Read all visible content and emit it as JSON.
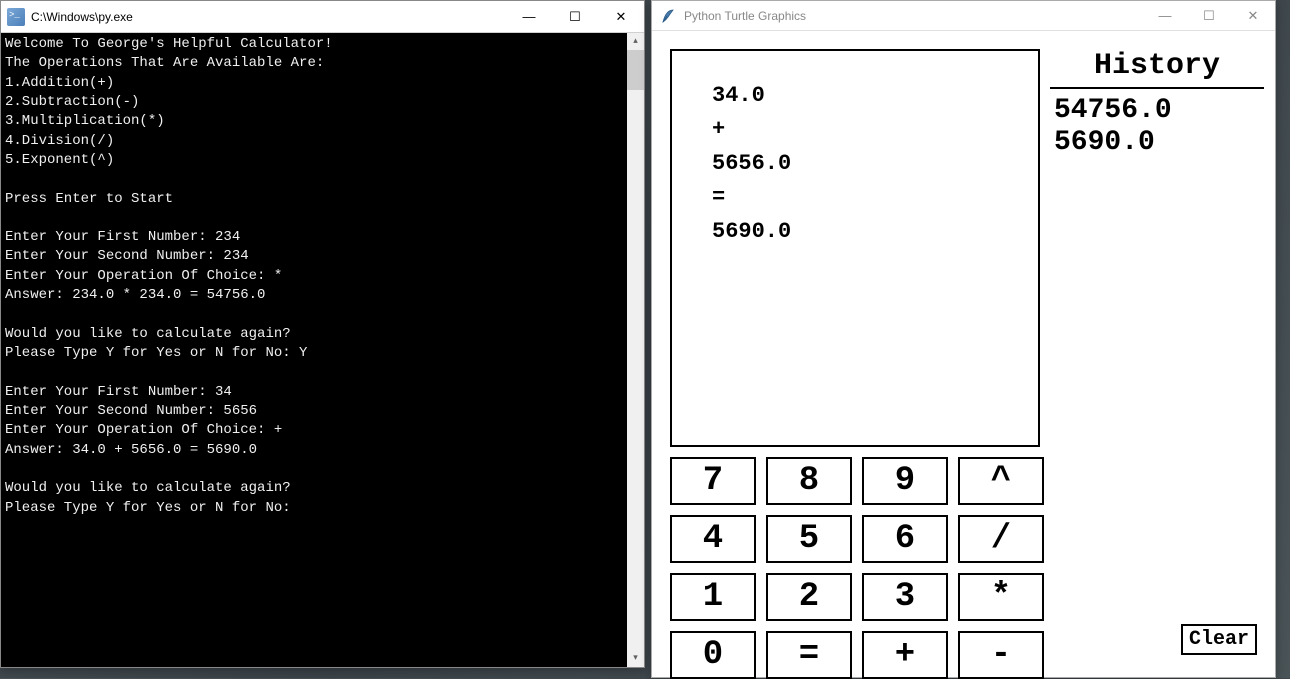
{
  "console": {
    "title": "C:\\Windows\\py.exe",
    "lines": [
      "Welcome To George's Helpful Calculator!",
      "The Operations That Are Available Are:",
      "1.Addition(+)",
      "2.Subtraction(-)",
      "3.Multiplication(*)",
      "4.Division(/)",
      "5.Exponent(^)",
      "",
      "Press Enter to Start",
      "",
      "Enter Your First Number: 234",
      "Enter Your Second Number: 234",
      "Enter Your Operation Of Choice: *",
      "Answer: 234.0 * 234.0 = 54756.0",
      "",
      "Would you like to calculate again?",
      "Please Type Y for Yes or N for No: Y",
      "",
      "Enter Your First Number: 34",
      "Enter Your Second Number: 5656",
      "Enter Your Operation Of Choice: +",
      "Answer: 34.0 + 5656.0 = 5690.0",
      "",
      "Would you like to calculate again?",
      "Please Type Y for Yes or N for No: "
    ]
  },
  "turtle": {
    "title": "Python Turtle Graphics",
    "display": {
      "operand1": "34.0",
      "operator": "+",
      "operand2": "5656.0",
      "equals": "=",
      "result": "5690.0"
    },
    "keypad": {
      "rows": [
        [
          "7",
          "8",
          "9",
          "^"
        ],
        [
          "4",
          "5",
          "6",
          "/"
        ],
        [
          "1",
          "2",
          "3",
          "*"
        ],
        [
          "0",
          "=",
          "+",
          "-"
        ]
      ]
    },
    "history": {
      "title": "History",
      "items": [
        "54756.0",
        "5690.0"
      ]
    },
    "clear_label": "Clear"
  },
  "window_controls": {
    "minimize": "—",
    "maximize": "☐",
    "close": "✕"
  }
}
